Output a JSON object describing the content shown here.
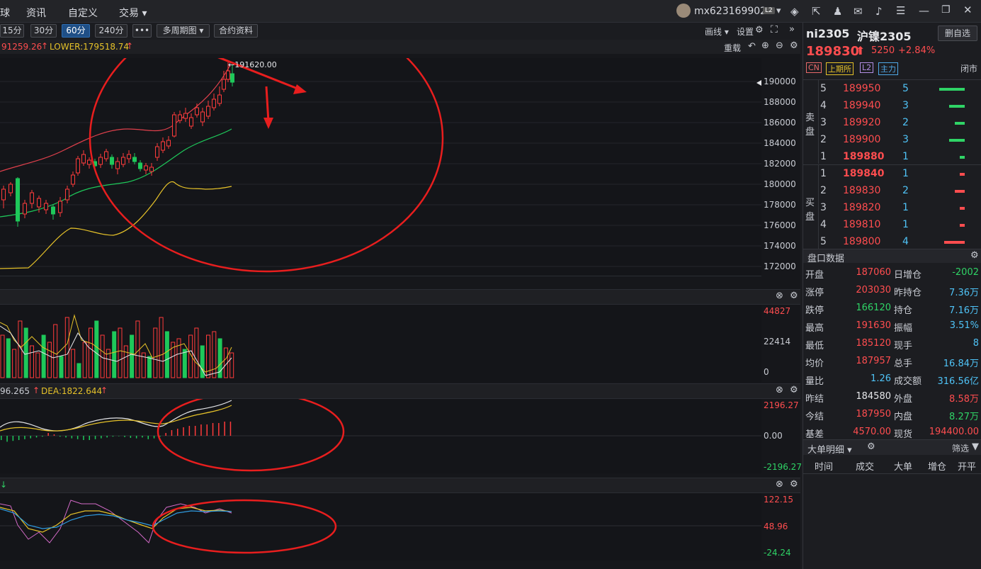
{
  "menu": {
    "items": [
      "球",
      "资讯",
      "自定义",
      "交易 ▾"
    ]
  },
  "account": {
    "user": "mx623169902",
    "badge": "L2"
  },
  "toolbar": {
    "periods": [
      "15分",
      "30分",
      "60分",
      "240分",
      "•••",
      "多周期图 ▾",
      "合约资料"
    ],
    "active_period": "60分",
    "draw": "画线 ▾",
    "settings": "设置"
  },
  "indicator": {
    "upper": "91259.26",
    "lower": "LOWER:179518.74",
    "reset": "重载",
    "high_mark": "191620.00"
  },
  "price_axis": [
    "190000",
    "188000",
    "186000",
    "184000",
    "182000",
    "180000",
    "178000",
    "176000",
    "174000",
    "172000"
  ],
  "volume_axis": [
    "44827",
    "22414",
    "0"
  ],
  "macd": {
    "label_left": "96.265",
    "dea": "DEA:1822.644",
    "axis": [
      "2196.27",
      "0.00",
      "-2196.27"
    ]
  },
  "kdj": {
    "axis": [
      "122.15",
      "48.96",
      "-24.24"
    ]
  },
  "quote": {
    "code": "ni2305",
    "name": "沪镍2305",
    "delete_btn": "删自选",
    "price": "189830",
    "change": "5250",
    "change_pct": "+2.84%",
    "tags": [
      "CN",
      "上期所",
      "L2",
      "主力"
    ],
    "market_status": "闭市"
  },
  "orderbook": {
    "sell_label": [
      "卖",
      "盘"
    ],
    "buy_label": [
      "买",
      "盘"
    ],
    "asks": [
      {
        "level": "5",
        "price": "189950",
        "qty": "5",
        "bar": 1.0
      },
      {
        "level": "4",
        "price": "189940",
        "qty": "3",
        "bar": 0.6
      },
      {
        "level": "3",
        "price": "189920",
        "qty": "2",
        "bar": 0.4
      },
      {
        "level": "2",
        "price": "189900",
        "qty": "3",
        "bar": 0.6
      },
      {
        "level": "1",
        "price": "189880",
        "qty": "1",
        "bar": 0.2
      }
    ],
    "bids": [
      {
        "level": "1",
        "price": "189840",
        "qty": "1",
        "bar": 0.2
      },
      {
        "level": "2",
        "price": "189830",
        "qty": "2",
        "bar": 0.4
      },
      {
        "level": "3",
        "price": "189820",
        "qty": "1",
        "bar": 0.2
      },
      {
        "level": "4",
        "price": "189810",
        "qty": "1",
        "bar": 0.2
      },
      {
        "level": "5",
        "price": "189800",
        "qty": "4",
        "bar": 0.8
      }
    ]
  },
  "pankou": {
    "title": "盘口数据",
    "rows": [
      {
        "l1": "开盘",
        "v1": "187060",
        "c1": "red",
        "l2": "日增仓",
        "v2": "-2002",
        "c2": "green"
      },
      {
        "l1": "涨停",
        "v1": "203030",
        "c1": "red",
        "l2": "昨持仓",
        "v2": "7.36万",
        "c2": "cyan"
      },
      {
        "l1": "跌停",
        "v1": "166120",
        "c1": "green",
        "l2": "持仓",
        "v2": "7.16万",
        "c2": "cyan"
      },
      {
        "l1": "最高",
        "v1": "191630",
        "c1": "red",
        "l2": "振幅",
        "v2": "3.51%",
        "c2": "cyan"
      },
      {
        "l1": "最低",
        "v1": "185120",
        "c1": "red",
        "l2": "现手",
        "v2": "8",
        "c2": "cyan"
      },
      {
        "l1": "均价",
        "v1": "187957",
        "c1": "red",
        "l2": "总手",
        "v2": "16.84万",
        "c2": "cyan"
      },
      {
        "l1": "量比",
        "v1": "1.26",
        "c1": "cyan",
        "l2": "成交额",
        "v2": "316.56亿",
        "c2": "cyan"
      },
      {
        "l1": "昨结",
        "v1": "184580",
        "c1": "white",
        "l2": "外盘",
        "v2": "8.58万",
        "c2": "red"
      },
      {
        "l1": "今结",
        "v1": "187950",
        "c1": "red",
        "l2": "内盘",
        "v2": "8.27万",
        "c2": "green"
      },
      {
        "l1": "基差",
        "v1": "4570.00",
        "c1": "red",
        "l2": "现货",
        "v2": "194400.00",
        "c2": "red"
      }
    ]
  },
  "big_orders": {
    "title": "大单明细 ▾",
    "filter": "筛选",
    "columns": [
      "时间",
      "成交",
      "大单",
      "增仓",
      "开平"
    ]
  }
}
